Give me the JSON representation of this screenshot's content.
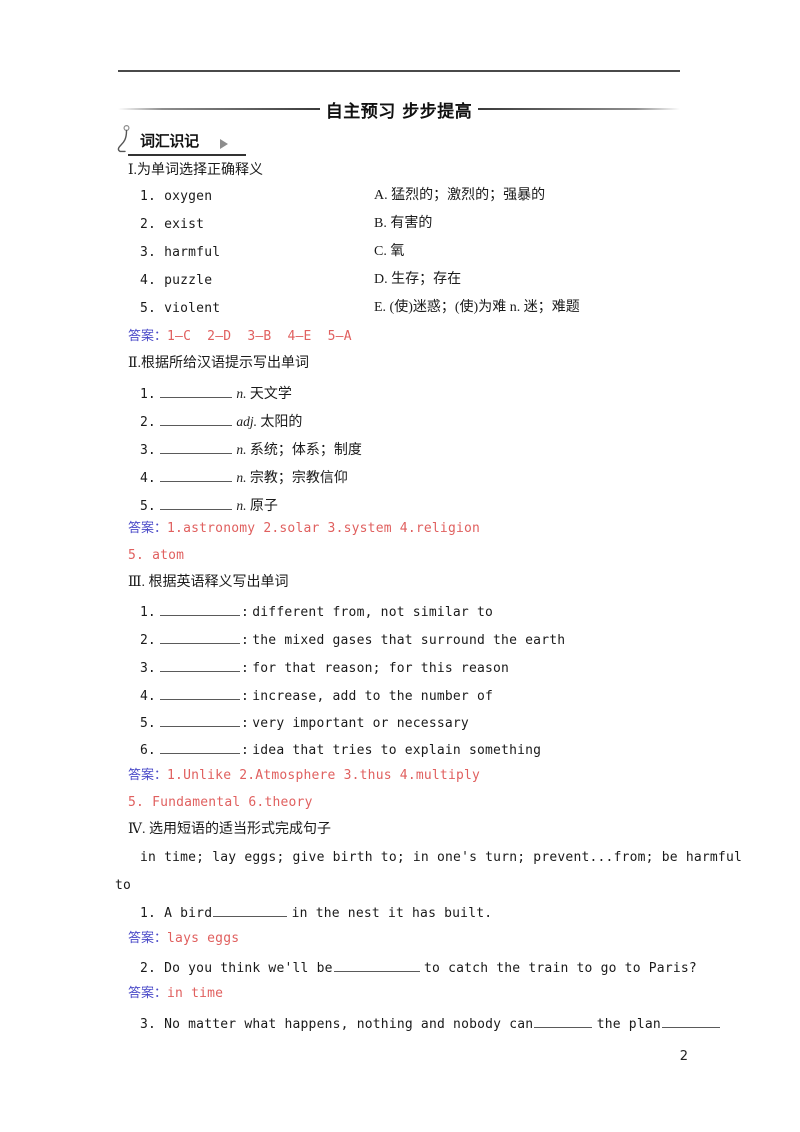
{
  "banner": {
    "title": "自主预习  步步提高"
  },
  "section_header": {
    "label": "词汇识记",
    "marker_icon": "triangle-right-icon",
    "hook_icon": "curly-hook-icon"
  },
  "answer_label": "答案：",
  "colors": {
    "answer_label": "#4a4ac8",
    "answer_text": "#e0605f",
    "rule": "#4a4a4a",
    "text": "#1a1a1a"
  },
  "exercises": [
    {
      "heading": "Ⅰ.为单词选择正确释义",
      "type": "matching",
      "left_items": [
        "1. oxygen",
        "2. exist",
        "3. harmful",
        "4. puzzle",
        "5. violent"
      ],
      "right_items": [
        "A. 猛烈的；激烈的；强暴的",
        "B. 有害的",
        "C. 氧",
        "D. 生存；存在",
        "E. (使)迷惑；(使)为难   n. 迷；难题"
      ],
      "answers": [
        "1—C",
        "2—D",
        "3—B",
        "4—E",
        "5—A"
      ]
    },
    {
      "heading": "Ⅱ.根据所给汉语提示写出单词",
      "type": "fill-chinese",
      "items": [
        {
          "num": "1.",
          "pos": "n.",
          "clue": "天文学"
        },
        {
          "num": "2.",
          "pos": "adj.",
          "clue": "太阳的"
        },
        {
          "num": "3.",
          "pos": "n.",
          "clue": "系统；体系；制度"
        },
        {
          "num": "4.",
          "pos": "n.",
          "clue": "宗教；宗教信仰"
        },
        {
          "num": "5.",
          "pos": "n.",
          "clue": "原子"
        }
      ],
      "answers_line1": "1.astronomy  2.solar  3.system  4.religion",
      "answers_line2": "5. atom"
    },
    {
      "heading": "Ⅲ. 根据英语释义写出单词",
      "type": "fill-english",
      "items": [
        {
          "num": "1.",
          "def": "different from, not similar to"
        },
        {
          "num": "2.",
          "def": "the mixed gases that surround the earth"
        },
        {
          "num": "3.",
          "def": "for that reason; for this reason"
        },
        {
          "num": "4.",
          "def": "increase, add to the number of"
        },
        {
          "num": "5.",
          "def": "very important or necessary"
        },
        {
          "num": "6.",
          "def": "idea that tries to explain something"
        }
      ],
      "answers_line1": "1.Unlike  2.Atmosphere  3.thus  4.multiply",
      "answers_line2": "5. Fundamental  6.theory"
    },
    {
      "heading": "Ⅳ. 选用短语的适当形式完成句子",
      "type": "phrase-bank",
      "bank_line1": "in time; lay eggs; give birth to; in one's turn; prevent...from; be harmful",
      "bank_line2": "to",
      "questions": [
        {
          "before": "1. A bird",
          "after": "in the nest it has built.",
          "answer": "lays eggs"
        },
        {
          "before": "2. Do you think we'll be",
          "after": "to catch the train to go to Paris?",
          "answer": "in time"
        },
        {
          "before": "3. No matter what  happens, nothing and nobody can",
          "middle": "the plan",
          "after": "",
          "answer": ""
        }
      ]
    }
  ],
  "page_number": "2"
}
